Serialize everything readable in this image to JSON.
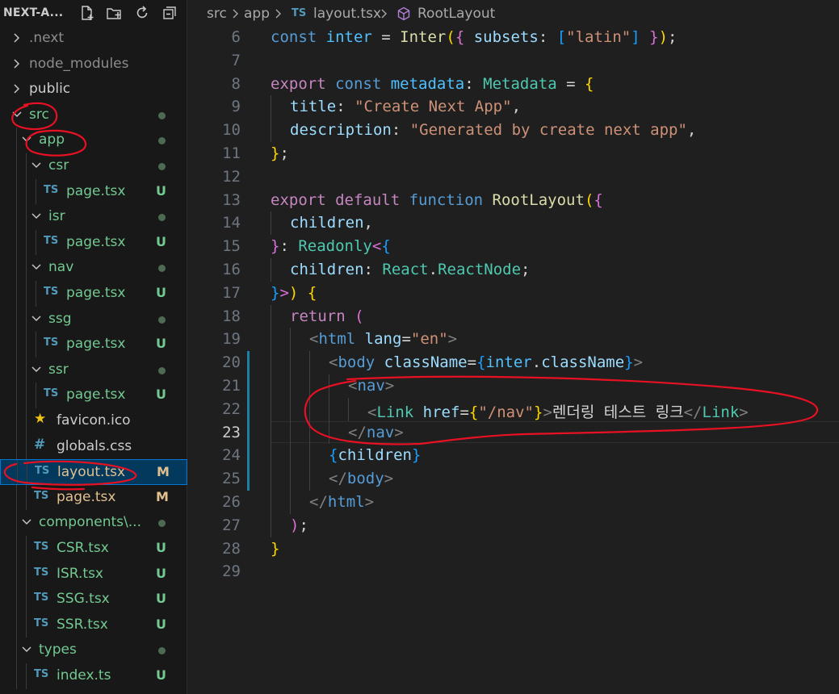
{
  "explorer": {
    "title": "NEXT-A...",
    "actions": [
      "new-file-icon",
      "new-folder-icon",
      "refresh-icon",
      "collapse-all-icon"
    ],
    "colors": {
      "folder": "#cccccc",
      "untracked": "#73c991",
      "modified": "#e2c08d",
      "ts_icon": "#519aba",
      "dot": "#4d6b52"
    },
    "items": [
      {
        "label": ".next",
        "depth": 0,
        "type": "folder",
        "expanded": false,
        "color": "#8c8c8c",
        "status": ""
      },
      {
        "label": "node_modules",
        "depth": 0,
        "type": "folder",
        "expanded": false,
        "color": "#8c8c8c",
        "status": ""
      },
      {
        "label": "public",
        "depth": 0,
        "type": "folder",
        "expanded": false,
        "color": "#cccccc",
        "status": ""
      },
      {
        "label": "src",
        "depth": 0,
        "type": "folder",
        "expanded": true,
        "color": "#73c991",
        "status": "dot"
      },
      {
        "label": "app",
        "depth": 1,
        "type": "folder",
        "expanded": true,
        "color": "#73c991",
        "status": "dot"
      },
      {
        "label": "csr",
        "depth": 2,
        "type": "folder",
        "expanded": true,
        "color": "#73c991",
        "status": "dot"
      },
      {
        "label": "page.tsx",
        "depth": 3,
        "type": "ts",
        "color": "#73c991",
        "status": "U"
      },
      {
        "label": "isr",
        "depth": 2,
        "type": "folder",
        "expanded": true,
        "color": "#73c991",
        "status": "dot"
      },
      {
        "label": "page.tsx",
        "depth": 3,
        "type": "ts",
        "color": "#73c991",
        "status": "U"
      },
      {
        "label": "nav",
        "depth": 2,
        "type": "folder",
        "expanded": true,
        "color": "#73c991",
        "status": "dot"
      },
      {
        "label": "page.tsx",
        "depth": 3,
        "type": "ts",
        "color": "#73c991",
        "status": "U"
      },
      {
        "label": "ssg",
        "depth": 2,
        "type": "folder",
        "expanded": true,
        "color": "#73c991",
        "status": "dot"
      },
      {
        "label": "page.tsx",
        "depth": 3,
        "type": "ts",
        "color": "#73c991",
        "status": "U"
      },
      {
        "label": "ssr",
        "depth": 2,
        "type": "folder",
        "expanded": true,
        "color": "#73c991",
        "status": "dot"
      },
      {
        "label": "page.tsx",
        "depth": 3,
        "type": "ts",
        "color": "#73c991",
        "status": "U"
      },
      {
        "label": "favicon.ico",
        "depth": 2,
        "type": "star",
        "color": "#cccccc",
        "status": ""
      },
      {
        "label": "globals.css",
        "depth": 2,
        "type": "css",
        "color": "#cccccc",
        "status": ""
      },
      {
        "label": "layout.tsx",
        "depth": 2,
        "type": "ts",
        "color": "#e2c08d",
        "status": "M",
        "selected": true
      },
      {
        "label": "page.tsx",
        "depth": 2,
        "type": "ts",
        "color": "#e2c08d",
        "status": "M"
      },
      {
        "label": "components\\...",
        "depth": 1,
        "type": "folder",
        "expanded": true,
        "color": "#73c991",
        "status": "dot"
      },
      {
        "label": "CSR.tsx",
        "depth": 2,
        "type": "ts",
        "color": "#73c991",
        "status": "U"
      },
      {
        "label": "ISR.tsx",
        "depth": 2,
        "type": "ts",
        "color": "#73c991",
        "status": "U"
      },
      {
        "label": "SSG.tsx",
        "depth": 2,
        "type": "ts",
        "color": "#73c991",
        "status": "U"
      },
      {
        "label": "SSR.tsx",
        "depth": 2,
        "type": "ts",
        "color": "#73c991",
        "status": "U"
      },
      {
        "label": "types",
        "depth": 1,
        "type": "folder",
        "expanded": true,
        "color": "#73c991",
        "status": "dot"
      },
      {
        "label": "index.ts",
        "depth": 2,
        "type": "ts",
        "color": "#73c991",
        "status": "U"
      }
    ]
  },
  "breadcrumb": {
    "parts": [
      "src",
      "app",
      "layout.tsx",
      "RootLayout"
    ],
    "ts_badge": "TS",
    "symbol_icon": "symbol-method-icon"
  },
  "editor": {
    "current_line": 23,
    "modified_lines": [
      20,
      25
    ],
    "lines": [
      {
        "n": 6,
        "indent": 0,
        "tokens": [
          [
            "kw",
            "const "
          ],
          [
            "var",
            "inter"
          ],
          [
            "punc",
            " = "
          ],
          [
            "fn",
            "Inter"
          ],
          [
            "b1",
            "("
          ],
          [
            "b2",
            "{"
          ],
          [
            "punc",
            " "
          ],
          [
            "prop",
            "subsets"
          ],
          [
            "punc",
            ": "
          ],
          [
            "b3",
            "["
          ],
          [
            "str",
            "\"latin\""
          ],
          [
            "b3",
            "]"
          ],
          [
            "punc",
            " "
          ],
          [
            "b2",
            "}"
          ],
          [
            "b1",
            ")"
          ],
          [
            "punc",
            ";"
          ]
        ]
      },
      {
        "n": 7,
        "indent": 0,
        "tokens": []
      },
      {
        "n": 8,
        "indent": 0,
        "tokens": [
          [
            "ctl",
            "export "
          ],
          [
            "kw",
            "const "
          ],
          [
            "var",
            "metadata"
          ],
          [
            "punc",
            ": "
          ],
          [
            "type",
            "Metadata"
          ],
          [
            "punc",
            " = "
          ],
          [
            "b1",
            "{"
          ]
        ]
      },
      {
        "n": 9,
        "indent": 1,
        "tokens": [
          [
            "prop",
            "title"
          ],
          [
            "punc",
            ": "
          ],
          [
            "str",
            "\"Create Next App\""
          ],
          [
            "punc",
            ","
          ]
        ]
      },
      {
        "n": 10,
        "indent": 1,
        "tokens": [
          [
            "prop",
            "description"
          ],
          [
            "punc",
            ": "
          ],
          [
            "str",
            "\"Generated by create next app\""
          ],
          [
            "punc",
            ","
          ]
        ]
      },
      {
        "n": 11,
        "indent": 0,
        "tokens": [
          [
            "b1",
            "}"
          ],
          [
            "punc",
            ";"
          ]
        ]
      },
      {
        "n": 12,
        "indent": 0,
        "tokens": []
      },
      {
        "n": 13,
        "indent": 0,
        "tokens": [
          [
            "ctl",
            "export "
          ],
          [
            "ctl",
            "default "
          ],
          [
            "kw",
            "function "
          ],
          [
            "fn",
            "RootLayout"
          ],
          [
            "b1",
            "("
          ],
          [
            "b2",
            "{"
          ]
        ]
      },
      {
        "n": 14,
        "indent": 1,
        "tokens": [
          [
            "prop",
            "children"
          ],
          [
            "punc",
            ","
          ]
        ]
      },
      {
        "n": 15,
        "indent": 0,
        "tokens": [
          [
            "b2",
            "}"
          ],
          [
            "punc",
            ": "
          ],
          [
            "type",
            "Readonly"
          ],
          [
            "b2",
            "<"
          ],
          [
            "b3",
            "{"
          ]
        ]
      },
      {
        "n": 16,
        "indent": 1,
        "tokens": [
          [
            "prop",
            "children"
          ],
          [
            "punc",
            ": "
          ],
          [
            "type",
            "React"
          ],
          [
            "punc",
            "."
          ],
          [
            "type",
            "ReactNode"
          ],
          [
            "punc",
            ";"
          ]
        ]
      },
      {
        "n": 17,
        "indent": 0,
        "tokens": [
          [
            "b3",
            "}"
          ],
          [
            "b2",
            ">"
          ],
          [
            "b1",
            ")"
          ],
          [
            "punc",
            " "
          ],
          [
            "b1",
            "{"
          ]
        ]
      },
      {
        "n": 18,
        "indent": 1,
        "tokens": [
          [
            "ctl",
            "return "
          ],
          [
            "b2",
            "("
          ]
        ]
      },
      {
        "n": 19,
        "indent": 2,
        "tokens": [
          [
            "tagp",
            "<"
          ],
          [
            "tag",
            "html"
          ],
          [
            "punc",
            " "
          ],
          [
            "attr",
            "lang"
          ],
          [
            "punc",
            "="
          ],
          [
            "str",
            "\"en\""
          ],
          [
            "tagp",
            ">"
          ]
        ]
      },
      {
        "n": 20,
        "indent": 3,
        "tokens": [
          [
            "tagp",
            "<"
          ],
          [
            "tag",
            "body"
          ],
          [
            "punc",
            " "
          ],
          [
            "attr",
            "className"
          ],
          [
            "punc",
            "="
          ],
          [
            "b3",
            "{"
          ],
          [
            "var",
            "inter"
          ],
          [
            "punc",
            "."
          ],
          [
            "prop",
            "className"
          ],
          [
            "b3",
            "}"
          ],
          [
            "tagp",
            ">"
          ]
        ]
      },
      {
        "n": 21,
        "indent": 4,
        "tokens": [
          [
            "tagp",
            "<"
          ],
          [
            "tag",
            "nav"
          ],
          [
            "tagp",
            ">"
          ]
        ]
      },
      {
        "n": 22,
        "indent": 5,
        "tokens": [
          [
            "tagp",
            "<"
          ],
          [
            "comp",
            "Link"
          ],
          [
            "punc",
            " "
          ],
          [
            "attr",
            "href"
          ],
          [
            "punc",
            "="
          ],
          [
            "b1",
            "{"
          ],
          [
            "str",
            "\"/nav\""
          ],
          [
            "b1",
            "}"
          ],
          [
            "tagp",
            ">"
          ],
          [
            "text",
            "렌더링 테스트 링크"
          ],
          [
            "tagp",
            "</"
          ],
          [
            "comp",
            "Link"
          ],
          [
            "tagp",
            ">"
          ]
        ]
      },
      {
        "n": 23,
        "indent": 4,
        "tokens": [
          [
            "tagp",
            "</"
          ],
          [
            "tag",
            "nav"
          ],
          [
            "tagp",
            ">"
          ]
        ]
      },
      {
        "n": 24,
        "indent": 3,
        "tokens": [
          [
            "b3",
            "{"
          ],
          [
            "prop",
            "children"
          ],
          [
            "b3",
            "}"
          ]
        ]
      },
      {
        "n": 25,
        "indent": 3,
        "tokens": [
          [
            "tagp",
            "</"
          ],
          [
            "tag",
            "body"
          ],
          [
            "tagp",
            ">"
          ]
        ]
      },
      {
        "n": 26,
        "indent": 2,
        "tokens": [
          [
            "tagp",
            "</"
          ],
          [
            "tag",
            "html"
          ],
          [
            "tagp",
            ">"
          ]
        ]
      },
      {
        "n": 27,
        "indent": 1,
        "tokens": [
          [
            "b2",
            ")"
          ],
          [
            "punc",
            ";"
          ]
        ]
      },
      {
        "n": 28,
        "indent": 0,
        "tokens": [
          [
            "b1",
            "}"
          ]
        ]
      },
      {
        "n": 29,
        "indent": 0,
        "tokens": []
      }
    ]
  },
  "annotations": {
    "color": "#e81123"
  }
}
